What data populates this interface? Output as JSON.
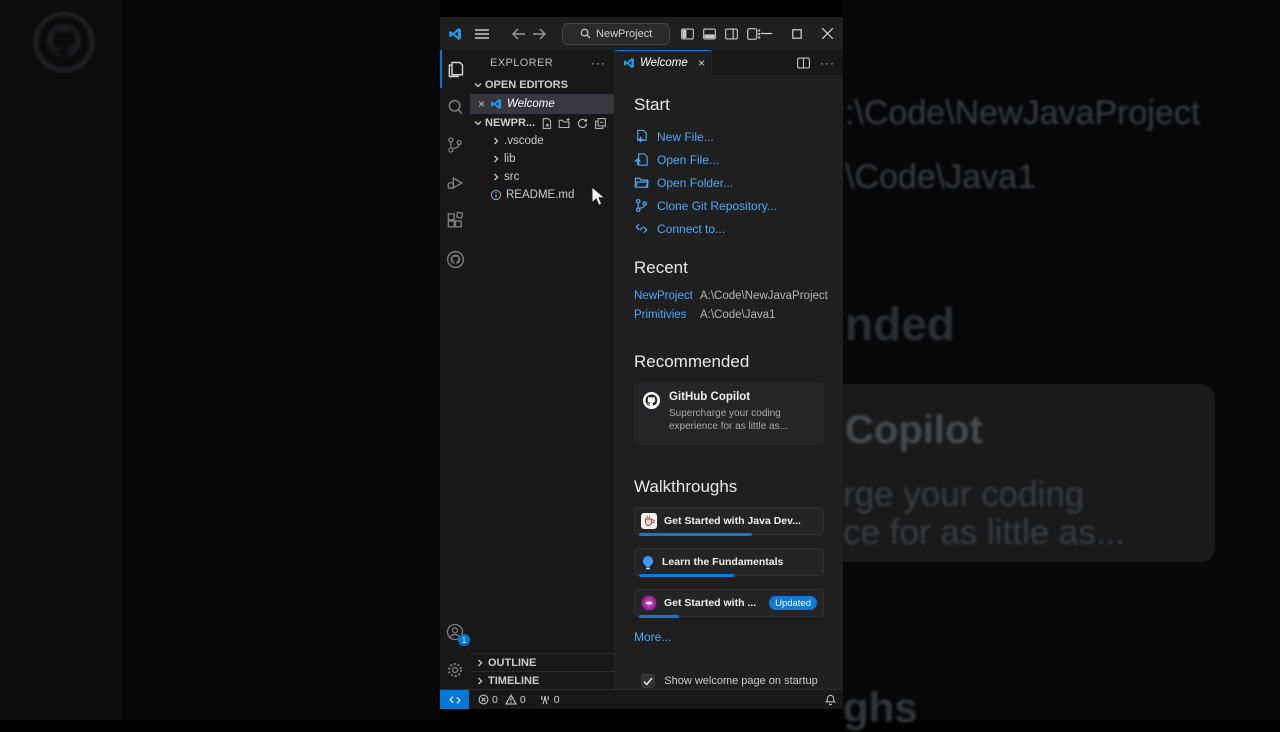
{
  "titlebar": {
    "search_value": "NewProject"
  },
  "activity_bar": {
    "account_badge": "1"
  },
  "sidebar": {
    "title": "EXPLORER",
    "more_actions": "···",
    "open_editors": {
      "label": "OPEN EDITORS",
      "close": "×",
      "items": [
        {
          "label": "Welcome"
        }
      ]
    },
    "folder": {
      "label": "NEWPR..."
    },
    "tree": [
      {
        "label": ".vscode"
      },
      {
        "label": "lib"
      },
      {
        "label": "src"
      },
      {
        "label": "README.md"
      }
    ],
    "outline_label": "OUTLINE",
    "timeline_label": "TIMELINE"
  },
  "editor": {
    "tab": {
      "label": "Welcome",
      "close": "×",
      "more_actions": "···"
    },
    "start": {
      "heading": "Start",
      "items": [
        "New File...",
        "Open File...",
        "Open Folder...",
        "Clone Git Repository...",
        "Connect to..."
      ]
    },
    "recent": {
      "heading": "Recent",
      "items": [
        {
          "name": "NewProject",
          "path": "A:\\Code\\NewJavaProject"
        },
        {
          "name": "Primitivies",
          "path": "A:\\Code\\Java1"
        }
      ]
    },
    "recommended": {
      "heading": "Recommended",
      "card": {
        "title": "GitHub Copilot",
        "line1": "Supercharge your coding",
        "line2": "experience for as little as..."
      }
    },
    "walkthroughs": {
      "heading": "Walkthroughs",
      "items": [
        {
          "label": "Get Started with Java Dev...",
          "progress": 62
        },
        {
          "label": "Learn the Fundamentals",
          "progress": 52
        },
        {
          "label": "Get Started with ...",
          "badge": "Updated",
          "progress": 22
        }
      ]
    },
    "more_label": "More...",
    "startup_checkbox": {
      "label": "Show welcome page on startup",
      "checked": true
    }
  },
  "status_bar": {
    "errors": "0",
    "warnings": "0",
    "ports": "0"
  },
  "background": {
    "right_fragments": {
      "path1": ":\\Code\\NewJavaProject",
      "path2": "\\Code\\Java1",
      "recommended_part": "nded",
      "copilot_title": "Copilot",
      "copilot_line1": "rge your coding",
      "copilot_line2": "ce for as little as...",
      "walkthroughs_part": "ghs"
    }
  },
  "colors": {
    "accent": "#0078d4",
    "link": "#4daafc",
    "editor_bg": "#1f1f1f",
    "chrome_bg": "#181818"
  }
}
